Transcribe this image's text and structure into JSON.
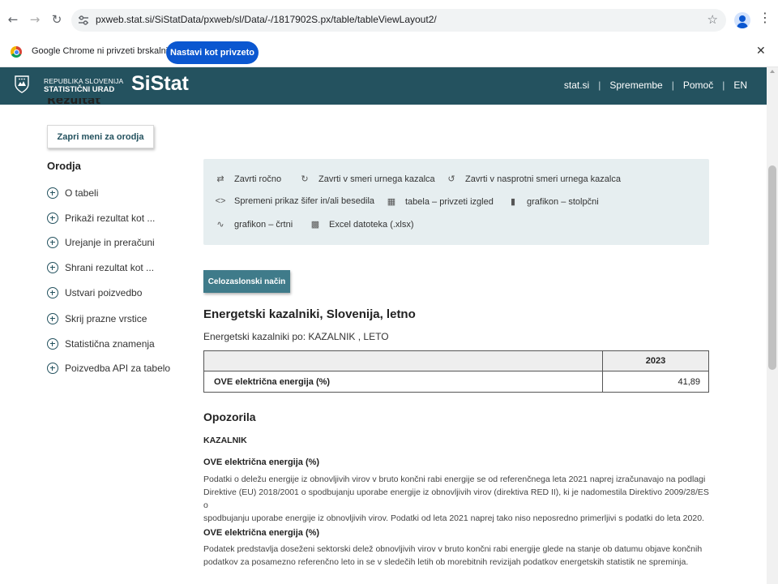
{
  "browser": {
    "url": "pxweb.stat.si/SiStatData/pxweb/sl/Data/-/1817902S.px/table/tableViewLayout2/",
    "infobar_text": "Google Chrome ni privzeti brskalnik",
    "infobar_button": "Nastavi kot privzeto"
  },
  "header": {
    "org_line1": "REPUBLIKA SLOVENIJA",
    "org_line2": "STATISTIČNI URAD",
    "brand": "SiStat",
    "nav": [
      "stat.si",
      "Spremembe",
      "Pomoč",
      "EN"
    ]
  },
  "sidebar": {
    "result_heading": "Rezultat",
    "close_menu_label": "Zapri meni za orodja",
    "tools_heading": "Orodja",
    "items": [
      {
        "label": "O tabeli"
      },
      {
        "label": "Prikaži rezultat kot ..."
      },
      {
        "label": "Urejanje in preračuni"
      },
      {
        "label": "Shrani rezultat kot ..."
      },
      {
        "label": "Ustvari poizvedbo"
      },
      {
        "label": "Skrij prazne vrstice"
      },
      {
        "label": "Statistična znamenja"
      },
      {
        "label": "Poizvedba API za tabelo"
      }
    ]
  },
  "toolbox": {
    "items": [
      {
        "label": "Zavrti ročno",
        "icon": "rotate-icon"
      },
      {
        "label": "Zavrti v smeri urnega kazalca",
        "icon": "rotate-clockwise-icon"
      },
      {
        "label": "Zavrti v nasprotni smeri urnega kazalca",
        "icon": "rotate-counterclockwise-icon"
      },
      {
        "label": "Spremeni prikaz šifer in/ali besedila",
        "icon": "code-icon"
      },
      {
        "label": "tabela – privzeti izgled",
        "icon": "table-icon"
      },
      {
        "label": "grafikon – stolpčni",
        "icon": "bar-chart-icon"
      },
      {
        "label": "grafikon – črtni",
        "icon": "line-chart-icon"
      },
      {
        "label": "Excel datoteka (.xlsx)",
        "icon": "excel-icon"
      }
    ]
  },
  "fullscreen_label": "Celozaslonski način",
  "table": {
    "title": "Energetski kazalniki, Slovenija, letno",
    "subtitle": "Energetski kazalniki po: KAZALNIK , LETO",
    "column_header": "2023",
    "row_label": "OVE električna energija (%)",
    "row_value": "41,89"
  },
  "notes": {
    "heading": "Opozorila",
    "section": "KAZALNIK",
    "items": [
      {
        "title": "OVE električna energija (%)",
        "lines": [
          "Podatki o deležu energije iz obnovljivih virov v bruto končni rabi energije se od referenčnega leta 2021 naprej izračunavajo na podlagi",
          "Direktive (EU) 2018/2001 o spodbujanju uporabe energije iz obnovljivih virov (direktiva RED II), ki je nadomestila Direktivo 2009/28/ES o",
          "spodbujanju uporabe energije iz obnovljivih virov. Podatki od leta 2021 naprej tako niso neposredno primerljivi s podatki do leta 2020."
        ]
      },
      {
        "title": "OVE električna energija (%)",
        "lines": [
          "Podatek predstavlja doseženi sektorski delež obnovljivih virov v bruto končni rabi energije glede na stanje ob datumu objave končnih",
          "podatkov za posamezno referenčno leto in se v sledečih letih ob morebitnih revizijah podatkov energetskih statistik ne spreminja."
        ]
      }
    ]
  }
}
